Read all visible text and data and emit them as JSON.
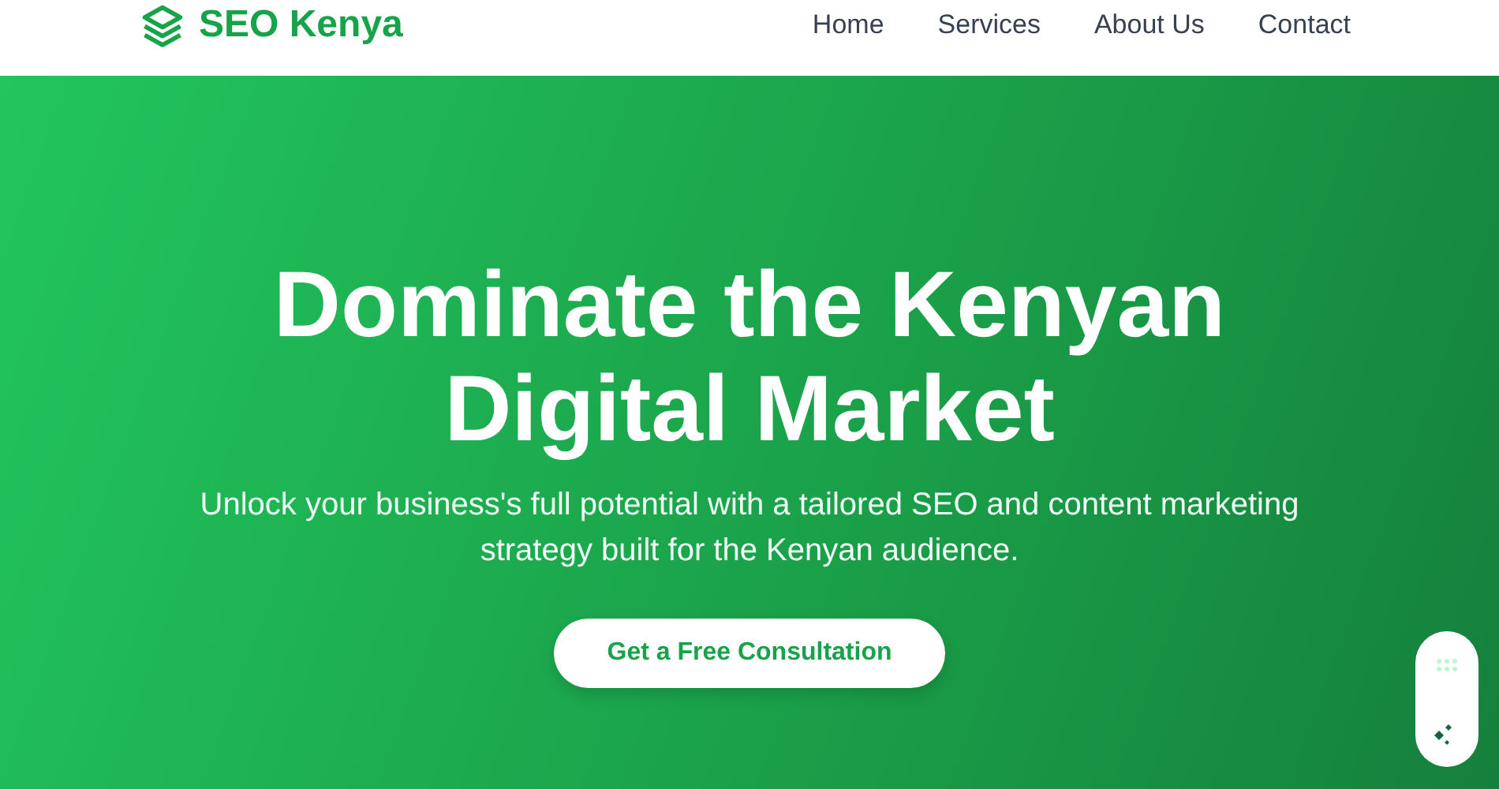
{
  "header": {
    "logo": "SEO Kenya",
    "nav": [
      {
        "label": "Home"
      },
      {
        "label": "Services"
      },
      {
        "label": "About Us"
      },
      {
        "label": "Contact"
      }
    ]
  },
  "hero": {
    "title": "Dominate the Kenyan Digital Market",
    "subtitle": "Unlock your business's full potential with a tailored SEO and content marketing strategy built for the Kenyan audience.",
    "cta": "Get a Free Consultation"
  }
}
